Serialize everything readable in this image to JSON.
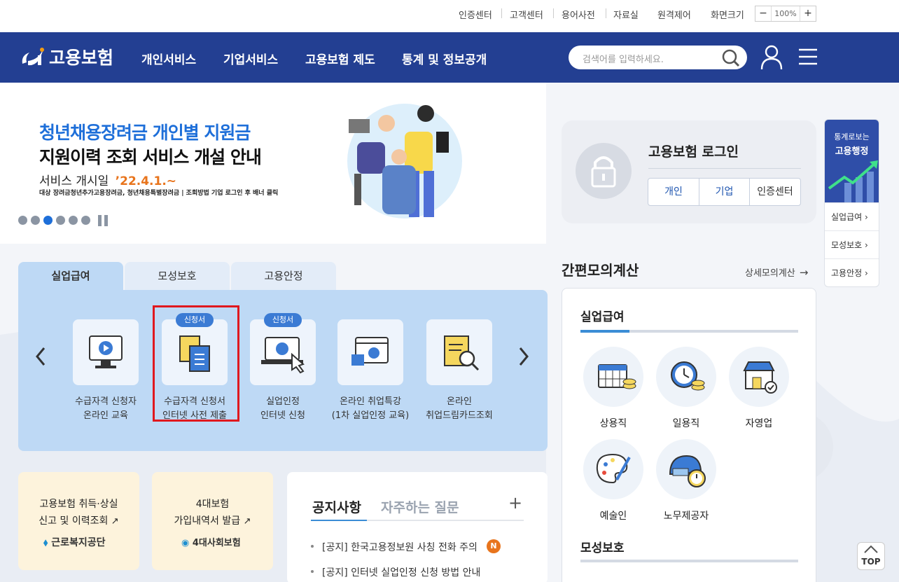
{
  "util": {
    "items": [
      "인증센터",
      "고객센터",
      "용어사전",
      "자료실",
      "원격제어",
      "화면크기"
    ],
    "zoom": {
      "minus": "−",
      "value": "100%",
      "plus": "+"
    }
  },
  "logo": {
    "text": "고용보험"
  },
  "nav": [
    "개인서비스",
    "기업서비스",
    "고용보험 제도",
    "통계 및 정보공개"
  ],
  "search": {
    "placeholder": "검색어를 입력하세요."
  },
  "banner": {
    "line1": "청년채용장려금 개인별 지원금",
    "line2": "지원이력 조회 서비스 개설 안내",
    "line3_label": "서비스 개시일",
    "line3_date": "’22.4.1.~",
    "note": "대상 장려금청년추가고용장려금, 청년채용특별장려금 | 조회방법 기업 로그인 후 배너 클릭"
  },
  "login": {
    "title": "고용보험 로그인",
    "buttons": [
      "개인",
      "기업",
      "인증센터"
    ]
  },
  "side": {
    "title1": "통계로보는",
    "title2": "고용행정",
    "links": [
      "실업급여 ›",
      "모성보호 ›",
      "고용안정 ›"
    ]
  },
  "tabs": [
    "실업급여",
    "모성보호",
    "고용안정"
  ],
  "services": [
    {
      "l1": "수급자격 신청자",
      "l2": "온라인 교육",
      "badge": ""
    },
    {
      "l1": "수급자격 신청서",
      "l2": "인터넷 사전 제출",
      "badge": "신청서"
    },
    {
      "l1": "실업인정",
      "l2": "인터넷 신청",
      "badge": "신청서"
    },
    {
      "l1": "온라인 취업특강",
      "l2": "(1차 실업인정 교육)",
      "badge": ""
    },
    {
      "l1": "온라인",
      "l2": "취업드림카드조회",
      "badge": ""
    }
  ],
  "calc": {
    "title": "간편모의계산",
    "more": "상세모의계산",
    "section1": "실업급여",
    "items": [
      "상용직",
      "일용직",
      "자영업",
      "예술인",
      "노무제공자"
    ],
    "section2": "모성보호"
  },
  "quick": [
    {
      "l1": "고용보험 취득·상실",
      "l2": "신고 및 이력조회",
      "org": "근로복지공단"
    },
    {
      "l1": "4대보험",
      "l2": "가입내역서 발급",
      "org": "4대사회보험"
    }
  ],
  "notice": {
    "tab_active": "공지사항",
    "tab_other": "자주하는 질문",
    "plus": "+",
    "items": [
      "[공지] 한국고용정보원 사칭 전화 주의",
      "[공지] 인터넷 실업인정 신청 방법 안내"
    ],
    "new_badge": "N"
  },
  "top": {
    "label": "TOP"
  },
  "colors": {
    "brand": "#233f92",
    "accent": "#1e6fd9",
    "highlight": "#e0181e"
  }
}
